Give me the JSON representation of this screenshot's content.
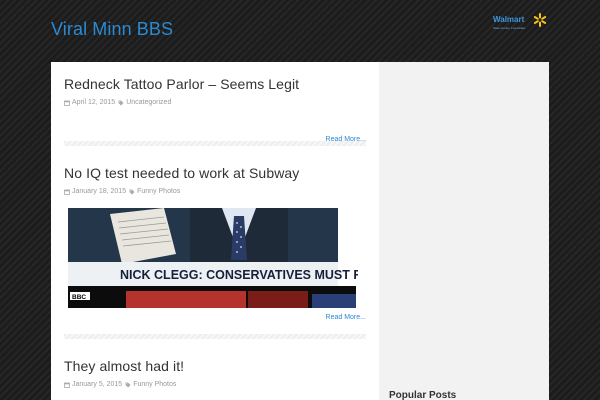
{
  "site": {
    "title": "Viral Minn BBS"
  },
  "ad": {
    "brand": "Walmart",
    "tagline": "Save money. Live better.",
    "accent": "#3d96e0",
    "spark_color": "#f5c518"
  },
  "posts": [
    {
      "title": "Redneck Tattoo Parlor – Seems Legit",
      "date": "April 12, 2015",
      "category": "Uncategorized",
      "read_more": "Read More..."
    },
    {
      "title": "No IQ test needed to work at Subway",
      "date": "January 18, 2015",
      "category": "Funny Photos",
      "read_more": "Read More...",
      "image": {
        "banner_text": "NICK CLEGG: CONSERVATIVES MUST R",
        "channel": "BBC"
      }
    },
    {
      "title": "They almost had it!",
      "date": "January 5, 2015",
      "category": "Funny Photos"
    }
  ],
  "sidebar": {
    "heading": "Popular Posts"
  },
  "colors": {
    "link": "#2a8ad4",
    "title_text": "#333333",
    "meta_text": "#999999"
  },
  "icons": {
    "date": "calendar-icon",
    "category": "tag-icon"
  }
}
